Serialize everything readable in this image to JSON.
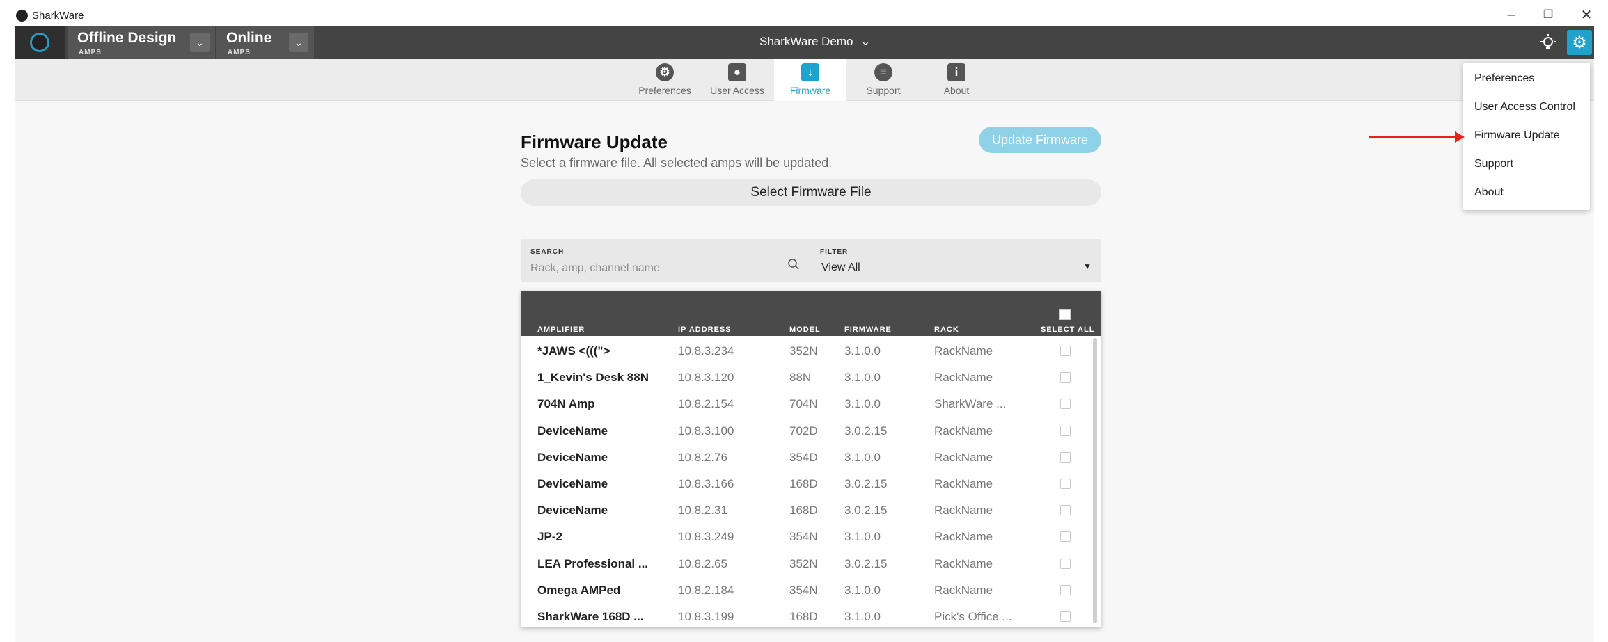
{
  "window": {
    "app_name": "SharkWare",
    "minimize_icon": "minimize-icon",
    "restore_icon": "restore-icon",
    "close_icon": "close-icon"
  },
  "appbar": {
    "modes": [
      {
        "title": "Offline Design",
        "subtitle": "AMPS"
      },
      {
        "title": "Online",
        "subtitle": "AMPS"
      }
    ],
    "project_title": "SharkWare Demo",
    "accent": "#1fa3cc"
  },
  "tabs": [
    {
      "label": "Preferences",
      "icon": "gear-icon"
    },
    {
      "label": "User Access",
      "icon": "user-icon"
    },
    {
      "label": "Firmware",
      "icon": "download-icon",
      "active": true
    },
    {
      "label": "Support",
      "icon": "chat-icon"
    },
    {
      "label": "About",
      "icon": "info-icon"
    }
  ],
  "firmware": {
    "title": "Firmware Update",
    "subtitle": "Select a firmware file. All selected amps will be updated.",
    "update_button": "Update Firmware",
    "select_file_button": "Select Firmware File"
  },
  "search": {
    "label": "SEARCH",
    "placeholder": "Rack, amp, channel name"
  },
  "filter": {
    "label": "FILTER",
    "value": "View All"
  },
  "table": {
    "headers": {
      "amplifier": "AMPLIFIER",
      "ip": "IP ADDRESS",
      "model": "MODEL",
      "firmware": "FIRMWARE",
      "rack": "RACK",
      "select_all": "SELECT ALL"
    },
    "rows": [
      {
        "name": "*JAWS <(((\">",
        "ip": "10.8.3.234",
        "model": "352N",
        "firmware": "3.1.0.0",
        "rack": "RackName"
      },
      {
        "name": "1_Kevin's Desk 88N",
        "ip": "10.8.3.120",
        "model": "88N",
        "firmware": "3.1.0.0",
        "rack": "RackName"
      },
      {
        "name": "704N Amp",
        "ip": "10.8.2.154",
        "model": "704N",
        "firmware": "3.1.0.0",
        "rack": "SharkWare ..."
      },
      {
        "name": "DeviceName",
        "ip": "10.8.3.100",
        "model": "702D",
        "firmware": "3.0.2.15",
        "rack": "RackName"
      },
      {
        "name": "DeviceName",
        "ip": "10.8.2.76",
        "model": "354D",
        "firmware": "3.1.0.0",
        "rack": "RackName"
      },
      {
        "name": "DeviceName",
        "ip": "10.8.3.166",
        "model": "168D",
        "firmware": "3.0.2.15",
        "rack": "RackName"
      },
      {
        "name": "DeviceName",
        "ip": "10.8.2.31",
        "model": "168D",
        "firmware": "3.0.2.15",
        "rack": "RackName"
      },
      {
        "name": "JP-2",
        "ip": "10.8.3.249",
        "model": "354N",
        "firmware": "3.1.0.0",
        "rack": "RackName"
      },
      {
        "name": "LEA Professional ...",
        "ip": "10.8.2.65",
        "model": "352N",
        "firmware": "3.0.2.15",
        "rack": "RackName"
      },
      {
        "name": "Omega AMPed",
        "ip": "10.8.2.184",
        "model": "354N",
        "firmware": "3.1.0.0",
        "rack": "RackName"
      },
      {
        "name": "SharkWare 168D ...",
        "ip": "10.8.3.199",
        "model": "168D",
        "firmware": "3.1.0.0",
        "rack": "Pick's Office ..."
      }
    ]
  },
  "settings_menu": {
    "items": [
      "Preferences",
      "User Access Control",
      "Firmware Update",
      "Support",
      "About"
    ],
    "highlight_color": "#e8211c"
  }
}
